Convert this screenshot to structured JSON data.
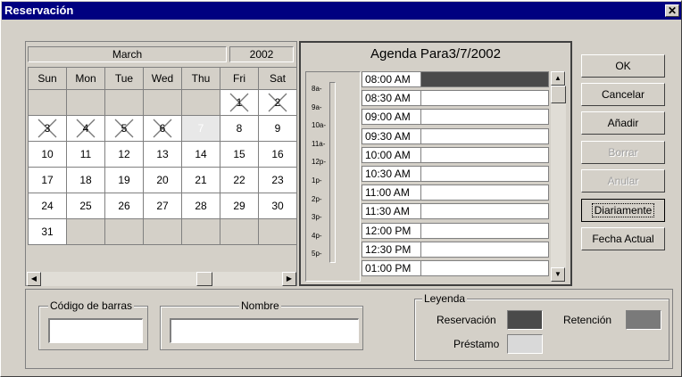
{
  "window": {
    "title": "Reservación",
    "close_symbol": "✕"
  },
  "calendar": {
    "month": "March",
    "year": "2002",
    "weekdays": [
      "Sun",
      "Mon",
      "Tue",
      "Wed",
      "Thu",
      "Fri",
      "Sat"
    ],
    "weeks": [
      [
        "",
        "",
        "",
        "",
        "",
        "1",
        "2"
      ],
      [
        "3",
        "4",
        "5",
        "6",
        "7",
        "8",
        "9"
      ],
      [
        "10",
        "11",
        "12",
        "13",
        "14",
        "15",
        "16"
      ],
      [
        "17",
        "18",
        "19",
        "20",
        "21",
        "22",
        "23"
      ],
      [
        "24",
        "25",
        "26",
        "27",
        "28",
        "29",
        "30"
      ],
      [
        "31",
        "",
        "",
        "",
        "",
        "",
        ""
      ]
    ],
    "crossed_days": [
      "1",
      "2",
      "3",
      "4",
      "5",
      "6"
    ],
    "today": "7"
  },
  "agenda": {
    "title": "Agenda Para3/7/2002",
    "hour_labels": [
      "8a-",
      "9a-",
      "10a-",
      "11a-",
      "12p-",
      "1p-",
      "2p-",
      "3p-",
      "4p-",
      "5p-"
    ],
    "slots": [
      "08:00 AM",
      "08:30 AM",
      "09:00 AM",
      "09:30 AM",
      "10:00 AM",
      "10:30 AM",
      "11:00 AM",
      "11:30 AM",
      "12:00 PM",
      "12:30 PM",
      "01:00 PM"
    ],
    "reserved_slot": "08:00 AM"
  },
  "buttons": {
    "ok": "OK",
    "cancel": "Cancelar",
    "add": "Añadir",
    "delete": "Borrar",
    "void": "Anular",
    "daily": "Diariamente",
    "today": "Fecha Actual"
  },
  "fields": {
    "barcode_label": "Código de barras",
    "barcode_value": "",
    "name_label": "Nombre",
    "name_value": ""
  },
  "legend": {
    "title": "Leyenda",
    "reservation": "Reservación",
    "retention": "Retención",
    "loan": "Préstamo"
  },
  "colors": {
    "reservation": "#4a4a4a",
    "retention": "#7a7a7a",
    "loan": "#d9d9d9",
    "titlebar": "#000080",
    "dialog": "#d4d0c8"
  }
}
